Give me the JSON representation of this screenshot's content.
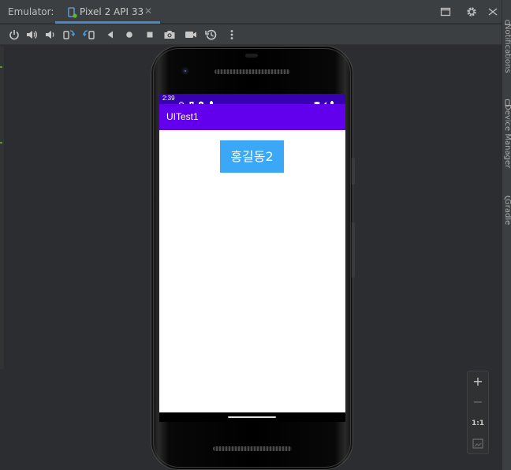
{
  "panel": {
    "title": "Emulator:"
  },
  "tab": {
    "label": "Pixel 2 API 33",
    "close_glyph": "✕",
    "icon": "phone-run-icon"
  },
  "header_actions": [
    {
      "name": "restore-window-icon"
    },
    {
      "name": "settings-gear-icon"
    },
    {
      "name": "more-options-icon"
    }
  ],
  "toolbar": [
    {
      "name": "power-icon"
    },
    {
      "name": "volume-up-icon"
    },
    {
      "name": "volume-down-icon"
    },
    {
      "name": "rotate-left-icon"
    },
    {
      "name": "rotate-right-icon"
    },
    {
      "name": "back-icon"
    },
    {
      "name": "home-icon"
    },
    {
      "name": "overview-icon"
    },
    {
      "name": "camera-icon"
    },
    {
      "name": "screen-record-icon"
    },
    {
      "name": "snapshot-icon"
    },
    {
      "name": "extended-controls-icon"
    }
  ],
  "side_tools": [
    {
      "label": "Notifications",
      "icon": "bell-icon"
    },
    {
      "label": "Device Manager",
      "icon": "device-manager-icon"
    },
    {
      "label": "Gradle",
      "icon": "gradle-icon"
    }
  ],
  "device": {
    "status_bar": {
      "time": "2:39",
      "left_icons": [
        "settings-icon",
        "sim-icon",
        "shield-icon",
        "battery-saver-icon"
      ],
      "right_icons": [
        "wifi-icon",
        "signal-icon",
        "battery-icon"
      ],
      "color": "#3700b3"
    },
    "app_bar": {
      "title": "UITest1",
      "color": "#6200ee"
    },
    "button": {
      "label": "홍길동2",
      "color": "#3aa8f7"
    }
  },
  "zoom_controls": {
    "zoom_in": "+",
    "zoom_out": "−",
    "actual_size": "1:1",
    "fit": "fit-screen-icon"
  }
}
